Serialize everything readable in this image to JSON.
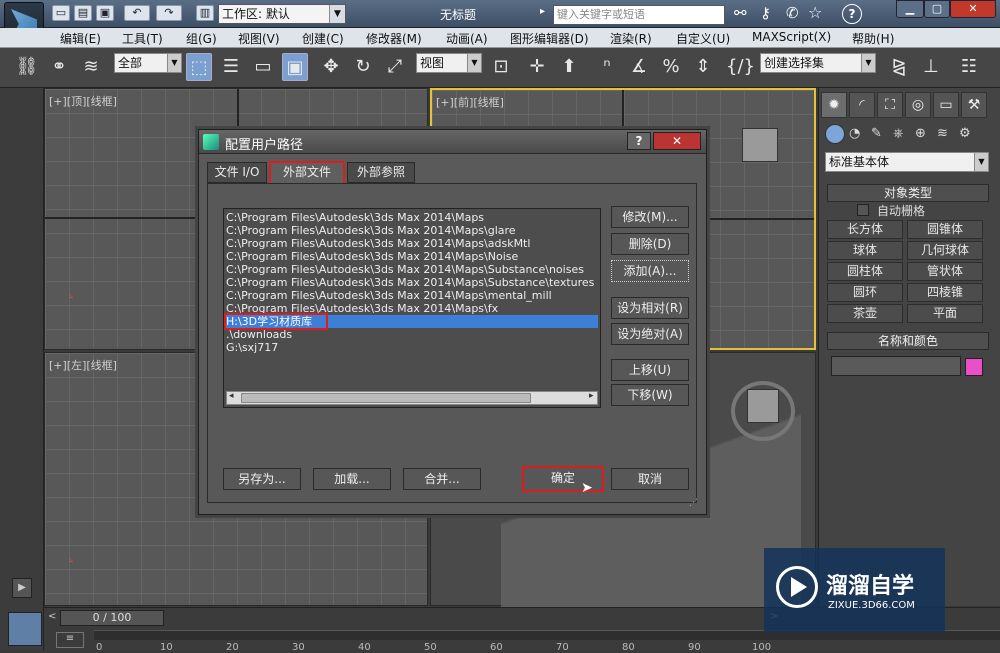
{
  "app": {
    "document_title": "无标题",
    "workspace_label": "工作区: 默认",
    "search_placeholder": "键入关键字或短语"
  },
  "menu": [
    "编辑(E)",
    "工具(T)",
    "组(G)",
    "视图(V)",
    "创建(C)",
    "修改器(M)",
    "动画(A)",
    "图形编辑器(D)",
    "渲染(R)",
    "自定义(U)",
    "MAXScript(X)",
    "帮助(H)"
  ],
  "toolbar": {
    "filter_value": "全部",
    "view_value": "视图",
    "selection_set_value": "创建选择集"
  },
  "viewports": {
    "top": "[+][顶][线框]",
    "front": "[+][前][线框]",
    "left": "[+][左][线框]"
  },
  "command_panel": {
    "dropdown_value": "标准基本体",
    "object_type_title": "对象类型",
    "auto_grid_label": "自动栅格",
    "buttons": [
      "长方体",
      "圆锥体",
      "球体",
      "几何球体",
      "圆柱体",
      "管状体",
      "圆环",
      "四棱锥",
      "茶壶",
      "平面"
    ],
    "name_color_title": "名称和颜色",
    "object_color": "#e84fc8"
  },
  "dialog": {
    "title": "配置用户路径",
    "tabs": [
      "文件 I/O",
      "外部文件",
      "外部参照"
    ],
    "active_tab_index": 1,
    "paths": [
      "C:\\Program Files\\Autodesk\\3ds Max 2014\\Maps",
      "C:\\Program Files\\Autodesk\\3ds Max 2014\\Maps\\glare",
      "C:\\Program Files\\Autodesk\\3ds Max 2014\\Maps\\adskMtl",
      "C:\\Program Files\\Autodesk\\3ds Max 2014\\Maps\\Noise",
      "C:\\Program Files\\Autodesk\\3ds Max 2014\\Maps\\Substance\\noises",
      "C:\\Program Files\\Autodesk\\3ds Max 2014\\Maps\\Substance\\textures",
      "C:\\Program Files\\Autodesk\\3ds Max 2014\\Maps\\mental_mill",
      "C:\\Program Files\\Autodesk\\3ds Max 2014\\Maps\\fx",
      "H:\\3D学习材质库",
      ".\\downloads",
      "G:\\sxj717"
    ],
    "selected_index": 8,
    "side_buttons": [
      "修改(M)...",
      "删除(D)",
      "添加(A)...",
      "设为相对(R)",
      "设为绝对(A)",
      "上移(U)",
      "下移(W)"
    ],
    "bottom_buttons": {
      "save_as": "另存为...",
      "load": "加载...",
      "merge": "合并...",
      "ok": "确定",
      "cancel": "取消"
    },
    "help_glyph": "?",
    "close_glyph": "✕"
  },
  "timeline": {
    "frame_display": "0 / 100",
    "ticks": [
      "0",
      "10",
      "20",
      "30",
      "40",
      "50",
      "60",
      "70",
      "80",
      "90",
      "100"
    ]
  },
  "watermark": {
    "brand_text": "溜溜自学",
    "url_text": "ZIXUE.3D66.COM"
  }
}
